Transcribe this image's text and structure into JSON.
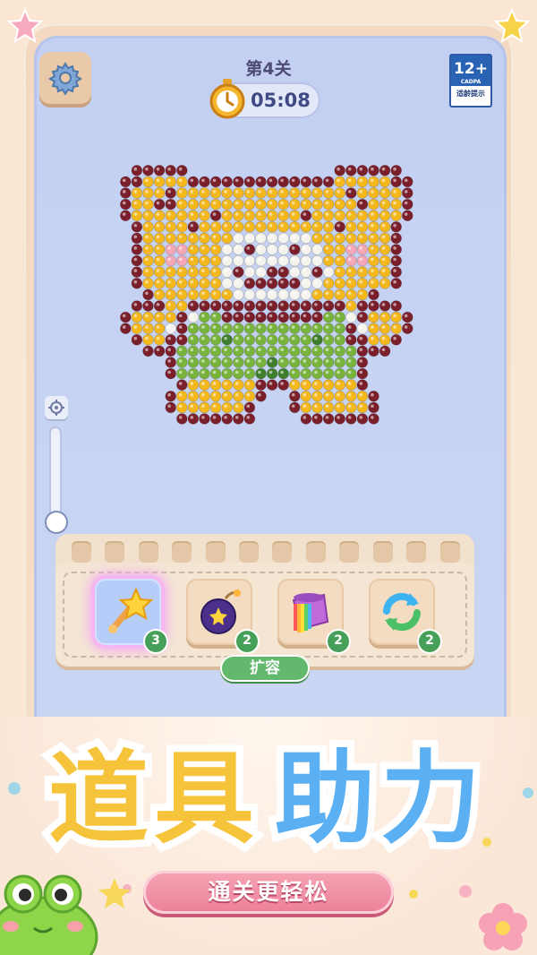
{
  "header": {
    "level_label": "第4关",
    "timer": "05:08",
    "age_rating": {
      "label": "12+",
      "org": "CADPA",
      "note": "适龄提示"
    }
  },
  "tools": {
    "items": [
      {
        "name": "magic wand",
        "count": "3",
        "selected": true
      },
      {
        "name": "bomb",
        "count": "2",
        "selected": false
      },
      {
        "name": "rainbow paint bucket",
        "count": "2",
        "selected": false
      },
      {
        "name": "refresh",
        "count": "2",
        "selected": false
      }
    ],
    "expand_label": "扩容"
  },
  "banner": {
    "title_part1": "道具",
    "title_part2": "助力",
    "subtitle": "通关更轻松"
  },
  "puzzle": {
    "palette": {
      "0": null,
      "D": "#7b1f2b",
      "Y": "#f4b81c",
      "W": "#f5f3ee",
      "P": "#f4a8b6",
      "G": "#78b43b",
      "H": "#3f7e2a"
    },
    "grid": [
      "0DDDDD0000000000000DDDDDD0",
      "DDYYYYDDDDDDDDDDDDDYYYYYDD",
      "DYYYDYYYYYYYYYYYYYYYDYYYYD",
      "DYYDDYYYYYYYYYYYYYYYYDYYYD",
      "DYYYYYYYDYYYYYYYDYYYYYYYYD",
      "0DYYYYDYYYYYYYYYYYYDYYYYD0",
      "0DYYYYYYYYWWWWWWWYYYYYYYD0",
      "0DYYPPYYYWWDWWWDWWYYPPYYD0",
      "0DYYPPYYYWWWWWWWWWYYPPYYD0",
      "0DYYYYYYYWDWWDDWWDWYYYYYD0",
      "0DYYYYYYYWWDDDDDWWYYYYYYD0",
      "00DYYYYYYYWWWWWWWYYYYYD000",
      "0DDDYYDDDDDDDDDDDDDDYDDDD0",
      "DYYYYDWGGDDDDDDDDDGGWDYYYD",
      "DYYYWDGGGGGGGGGGGGGGDWYYYD",
      "0DYYDDGGGHGGGGGGGHGGDDYYD0",
      "00DDDGGGGGGGGGGGGGGGGDDD00",
      "0000DGGGGGGGGHGGGGGGGD0000",
      "0000DGGGGGGGHHHGGGGGGD0000",
      "00000DYYYYYYDDDYYYYYYD0000",
      "0000DYYYYYYYD00DYYYYYYD000",
      "0000DYYYYYYD000DYYYYYYD000",
      "00000DDDDDDD0000DDDDDDD000"
    ]
  },
  "colors": {
    "accent_green": "#62b96e",
    "title_yellow": "#f6c43b",
    "title_blue": "#5ab0f2",
    "ribbon_pink": "#ec7f98"
  }
}
